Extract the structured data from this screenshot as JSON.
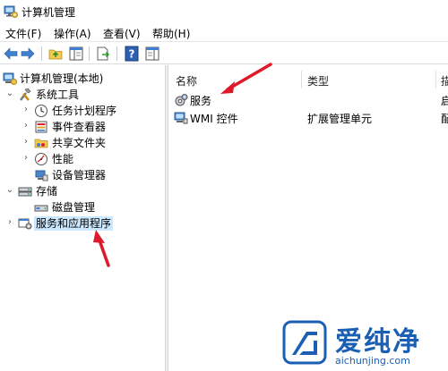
{
  "window": {
    "title": "计算机管理"
  },
  "menu": {
    "items": [
      "文件(F)",
      "操作(A)",
      "查看(V)",
      "帮助(H)"
    ]
  },
  "toolbar": {
    "buttons": [
      "back-icon",
      "forward-icon",
      "up-folder-icon",
      "show-hide-tree-icon",
      "export-list-icon",
      "help-icon",
      "action-pane-icon"
    ]
  },
  "tree": {
    "root": "计算机管理(本地)",
    "system_tools": "系统工具",
    "task_scheduler": "任务计划程序",
    "event_viewer": "事件查看器",
    "shared_folders": "共享文件夹",
    "performance": "性能",
    "device_manager": "设备管理器",
    "storage": "存储",
    "disk_management": "磁盘管理",
    "services_apps": "服务和应用程序"
  },
  "list": {
    "headers": {
      "name": "名称",
      "type": "类型",
      "desc": "描"
    },
    "rows": [
      {
        "name": "服务",
        "type": "",
        "desc": "启"
      },
      {
        "name": "WMI 控件",
        "type": "扩展管理单元",
        "desc": "配"
      }
    ]
  },
  "watermark": {
    "logo_text": "爱纯净",
    "url": "aichunjing.com"
  },
  "colors": {
    "selection": "#cce8ff",
    "annotation_arrow": "#e0192a",
    "watermark_blue": "#1a5fb4"
  }
}
